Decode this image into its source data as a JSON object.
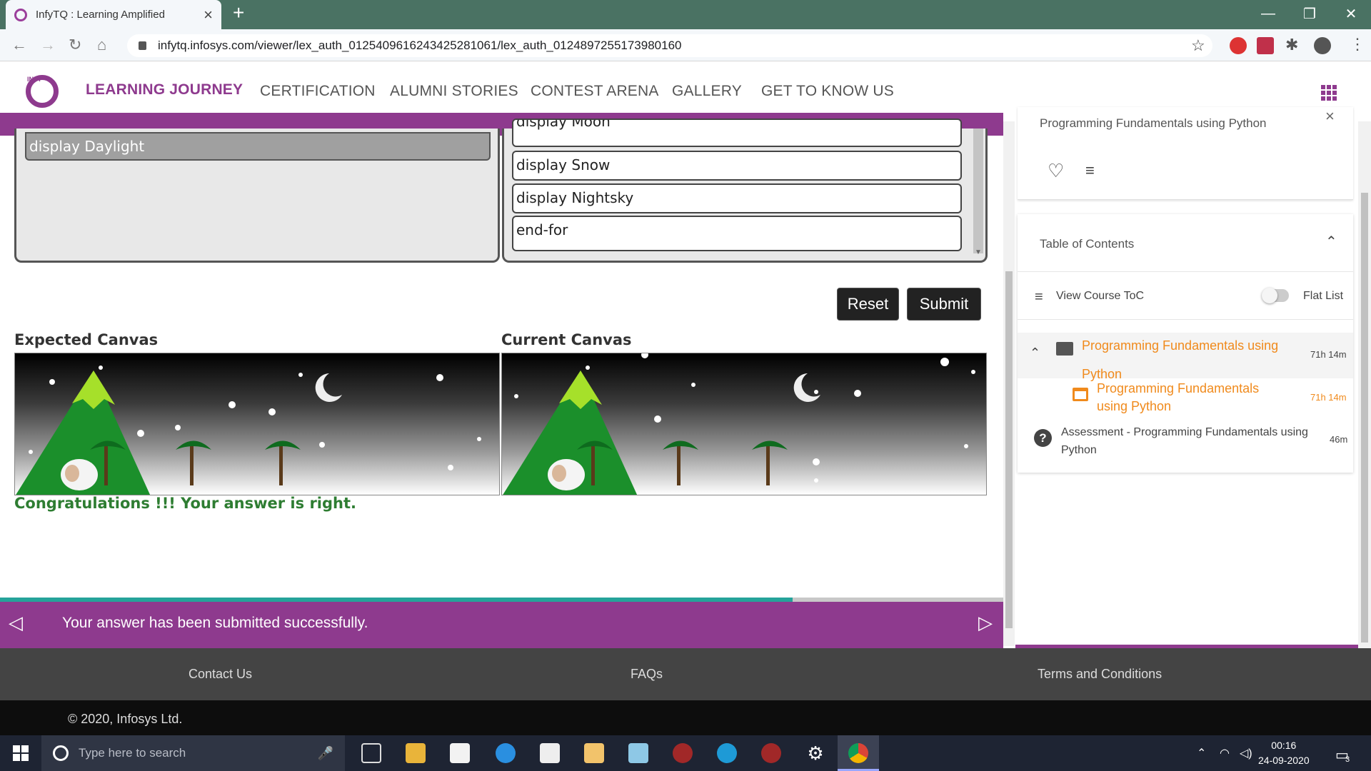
{
  "browser": {
    "tab_title": "InfyTQ : Learning Amplified",
    "url": "infytq.infosys.com/viewer/lex_auth_01254096162434252810​61/lex_auth_0124897255173980160",
    "window_controls": [
      "—",
      "❐",
      "✕"
    ]
  },
  "nav": {
    "logo_text": "INFY",
    "items": [
      {
        "label": "LEARNING JOURNEY",
        "active": true
      },
      {
        "label": "CERTIFICATION"
      },
      {
        "label": "ALUMNI STORIES"
      },
      {
        "label": "CONTEST ARENA"
      },
      {
        "label": "GALLERY"
      },
      {
        "label": "GET TO KNOW US"
      }
    ]
  },
  "exercise": {
    "left_block": "display Daylight",
    "code_blocks": [
      "display Moon",
      "display Snow",
      "display Nightsky",
      "end-for"
    ],
    "reset_label": "Reset",
    "submit_label": "Submit",
    "expected_label": "Expected Canvas",
    "current_label": "Current Canvas",
    "result_message": "Congratulations !!! Your answer is right.",
    "progress_percent": 79
  },
  "status_bar": {
    "message": "Your answer has been submitted successfully.",
    "prev_icon": "◁",
    "next_icon": "▷"
  },
  "sidebar": {
    "course_title": "Programming Fundamentals using Python",
    "toc_title": "Table of Contents",
    "view_course_toc": "View Course ToC",
    "flat_list": "Flat List",
    "module": {
      "title": "Programming Fundamentals using Python",
      "time": "71h 14m"
    },
    "resource": {
      "title": "Programming Fundamentals using Python",
      "time": "71h 14m"
    },
    "assessment": {
      "title": "Assessment - Programming Fundamentals using Python",
      "time": "46m"
    }
  },
  "footer": {
    "links": [
      "Contact Us",
      "FAQs",
      "Terms and Conditions"
    ],
    "copyright": "© 2020, Infosys Ltd."
  },
  "taskbar": {
    "search_placeholder": "Type here to search",
    "time": "00:16",
    "date": "24-09-2020",
    "notification_count": "3"
  },
  "colors": {
    "brand_purple": "#8e3a8e",
    "orange": "#f08a1c",
    "success_green": "#2e7d32",
    "progress_teal": "#25a39a"
  }
}
